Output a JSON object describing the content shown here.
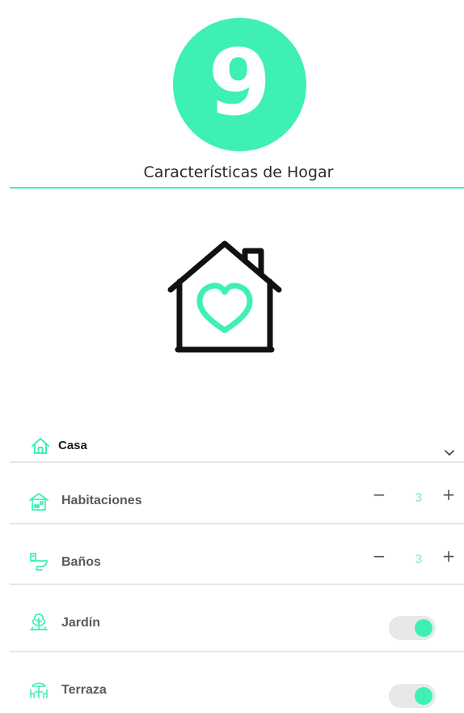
{
  "header": {
    "step_number": "9",
    "title": "Características de Hogar"
  },
  "colors": {
    "accent": "#3ef0b6",
    "divider": "#e6e6e6"
  },
  "property_type": {
    "icon": "house-outline-icon",
    "selected": "Casa"
  },
  "features": {
    "rooms": {
      "icon": "room-icon",
      "label": "Habitaciones",
      "value": "3",
      "minus": "−",
      "plus": "+"
    },
    "bathrooms": {
      "icon": "toilet-icon",
      "label": "Baños",
      "value": "3",
      "minus": "−",
      "plus": "+"
    },
    "garden": {
      "icon": "tree-icon",
      "label": "Jardín",
      "enabled": true
    },
    "terrace": {
      "icon": "umbrella-table-icon",
      "label": "Terraza",
      "enabled": true
    }
  }
}
